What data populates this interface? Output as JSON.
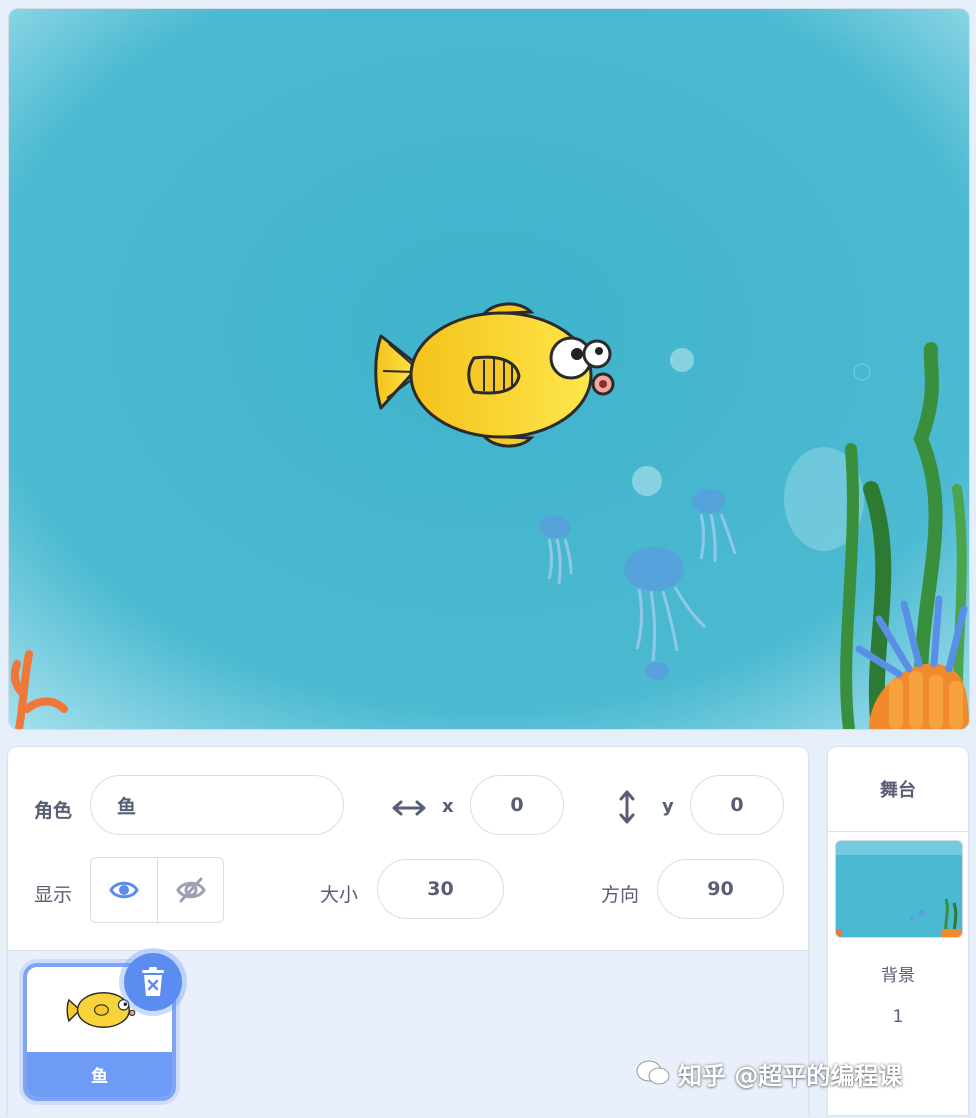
{
  "stage": {
    "sprite_name": "鱼"
  },
  "sprite_info": {
    "sprite_label": "角色",
    "sprite_name_value": "鱼",
    "x_label": "x",
    "x_value": "0",
    "y_label": "y",
    "y_value": "0",
    "show_label": "显示",
    "size_label": "大小",
    "size_value": "30",
    "direction_label": "方向",
    "direction_value": "90",
    "show_visible": true
  },
  "sprite_list": [
    {
      "name": "鱼",
      "selected": true
    }
  ],
  "stage_selector": {
    "title": "舞台",
    "backdrop_label": "背景",
    "backdrop_count": "1"
  },
  "watermark": {
    "text": "知乎 @超平的编程课"
  },
  "colors": {
    "accent": "#6e9bf5",
    "stage_water": "#4bb9d1",
    "text": "#575e75"
  }
}
